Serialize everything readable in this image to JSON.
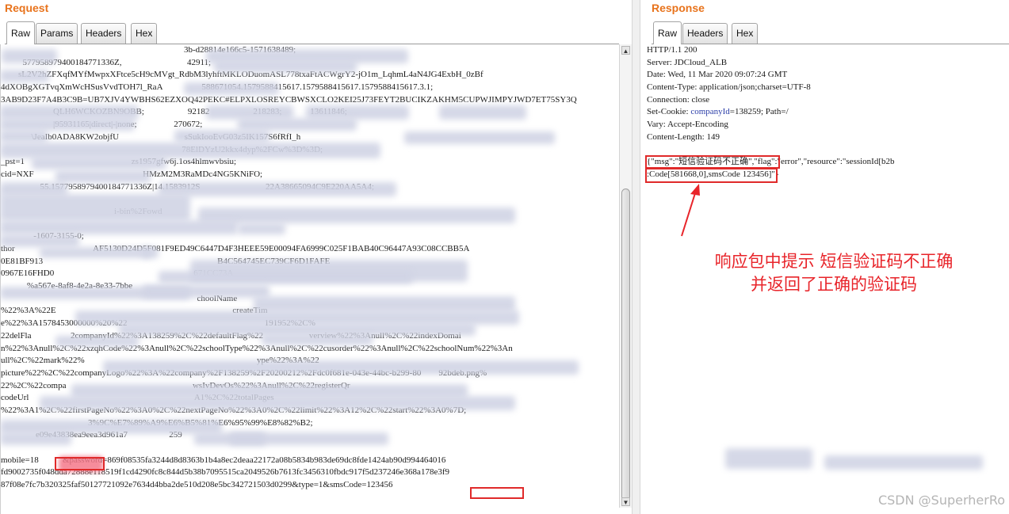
{
  "request": {
    "title": "Request",
    "tabs": [
      "Raw",
      "Params",
      "Headers",
      "Hex"
    ],
    "lines": [
      "                                                                                    3b-d28814e166c5-1571638489;",
      "          577958979400184771336Z,                              42911;",
      "        sL2V2hZFXqfMYfMwpxXFtce5cH9cMVgt_RdbM3lyhftMKLODuomASL778txaFtACWgrY2-jO1m_LqhmL4aN4JG4ExbH_0zBf",
      "4dXOBgXGTvqXmWcHSusVvdTOH7l_RaA                  588671054.1579588415617.1579588415617.1579588415617.3.1;",
      "3AB9D23F7A4B3C9B=UB7XJV4YWBHS62EZXOQ42PEKC#ELPXLOSREYCBWSXCLO2KEI25J73FEYT2BUCIKZAKHM5CUPWJIMPYJWD7ET75SY3Q",
      "                        QLH6WCKOZBN9OBB;                    92182                    218283;             13611846;",
      "                        |95931165|direct|-|none;                 270672;",
      "              \\JeaIb0ADA8KW2objfU                              sSukIooEvG03z5IK157S6fRfI_h",
      "                                                                                   78ElDYzU2kkx4dyp%2FCw%3D%3D;",
      "_pst=1                                                 zs1957gfw6j.1os4hlmwvbsiu;",
      "cid=NXF                                                  HMzM2M3RaMDc4NG5KNiFO;",
      "                  55.1577958979400184771336Z|14.1583912S                              22A38665094C9E220AA5A4;",
      "",
      "                                                    i-bin%2Fowd",
      "",
      "               -1607-3155-0;",
      "thor                                    AF5130D24D5F081F9ED49C6447D4F3HEEE59E00094FA6999C025F1BAB40C96447A93C08CCBB5A",
      "0E81BF913                                                                                B4C564745EC739CF6D1FAFE",
      "0967E16FHD0                                                                671CC73A",
      "            %a567e-8af8-4e2a-8e33-7bbe",
      "                                                                                          choolName",
      "%22%3A%22E                                                                                 createTim",
      "e%22%3A1578453000000%20%22                                                               191952%2C%",
      "22delFla                  2companyId%22%3A138259%2C%22defaultFlag%22                     verview%22%3Anull%2C%22indexDomai",
      "n%22%3Anull%2C%22xzqhCode%22%3Anull%2C%22schoolType%22%3Anull%2C%22cusorder%22%3Anull%2C%22schoolNum%22%3An",
      "ull%2C%22mark%22%                                                                               ype%22%3A%22",
      "picture%22%2C%22companyLogo%22%3A%22company%2F138259%2F20200212%2Fdc0f681e-043e-44bc-b299-80        92bdeb.png%",
      "22%2C%22compa                                                          wsIvDevOs%22%3Anull%2C%22registerQr",
      "codeUrl                                                                            A1%2C%22totalPages",
      "%22%3A1%2C%22firstPageNo%22%3A0%2C%22nextPageNo%22%3A0%2C%22limit%22%3A12%2C%22start%22%3A0%7D;",
      "                                        3%9C%E7%89%A9%E6%B5%81%E6%95%99%E8%82%B2;",
      "                e09e43838ea9eea3d961a7                   259",
      "",
      "mobile=18           &password=869f08535fa3244d8d8363b1b4a8ec2deaa22172a08b5834b983de69dc8fde1424ab90d994464016",
      "fd9002735f048dda72888e118519f1cd4290fc8c844d5b38b7095515ca2049526b7613fc3456310fbdc917f5d237246e368a178e3f9",
      "87f08e7fc7b320325faf50127721092e7634d4bba2de510d208e5bc342721503d0299&type=1&smsCode=123456"
    ]
  },
  "response": {
    "title": "Response",
    "tabs": [
      "Raw",
      "Headers",
      "Hex"
    ],
    "headers": [
      "HTTP/1.1 200",
      "Server: JDCloud_ALB",
      "Date: Wed, 11 Mar 2020 09:07:24 GMT",
      "Content-Type: application/json;charset=UTF-8",
      "Connection: close",
      "Set-Cookie: companyId=138259; Path=/",
      "Vary: Accept-Encoding",
      "Content-Length: 149"
    ],
    "cookie": {
      "prefix": "Set-Cookie: ",
      "key": "companyId",
      "rest": "=138259; Path=/"
    },
    "body_lines": [
      "{\"msg\":\"短信验证码不正确\",\"flag\":\"error\",\"resource\":\"sessionId[b2b",
      ":Code[581668,0],smsCode 123456]\"}"
    ]
  },
  "annotation": {
    "line1": "响应包中提示 短信验证码不正确",
    "line2": "并返回了正确的验证码"
  },
  "watermark": "CSDN @SuperherRo",
  "colors": {
    "title": "#e8731c",
    "highlight": "#e02a2a",
    "annotation": "#e8242a"
  }
}
